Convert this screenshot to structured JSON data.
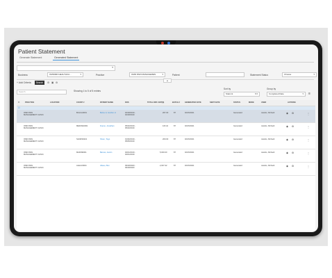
{
  "page": {
    "title": "Patient Statement",
    "tabs": [
      "Generate Statement",
      "Generated Statement"
    ],
    "active_tab": 1
  },
  "filters": {
    "business_label": "Business",
    "business_value": "OMNIMD HEALTHCA...",
    "practice_label": "Practice",
    "practice_value": "OMD PAIN MANAGEMEN",
    "patient_label": "Patient",
    "statement_status_label": "Statement Status",
    "statement_status_value": "Choose"
  },
  "toolbar": {
    "add_criteria": "+ Add Criteria",
    "search_button": "Search",
    "search_placeholder": "Search",
    "showing_text": "Showing 1 to 5 of 5 entries",
    "sort_by_label": "Sort by",
    "sort_by_value": "Statmnt",
    "group_by_label": "Group by",
    "group_by_value": "Completed Date"
  },
  "table": {
    "headers": [
      "PRACTICE",
      "LOCATION",
      "COUNT #",
      "PATIENT NAME",
      "DOS",
      "TOTAL DIFF AMT($)",
      "BATCH #",
      "GENERATED DATE",
      "SENT DATE",
      "STATUS",
      "MODE",
      "USER",
      "ACTIONS"
    ],
    "rows": [
      {
        "practice": "OMD PAIN MANAGEMENT CLINIC",
        "count": "BULCA0001",
        "patient": "Bulca Jr, Gordon H",
        "dos": "02/18/2019 - 02/18/2019",
        "amount": "267.00",
        "batch": "87",
        "generated": "02/15/2021",
        "status": "Generated",
        "user": "Jacobs, Richard"
      },
      {
        "practice": "OMD PAIN MANAGEMENT CLINIC",
        "count": "MEDINA0001",
        "patient": "Dueno, Jonathan",
        "dos": "05/20/2019 - 05/20/2019",
        "amount": "115.44",
        "batch": "87",
        "generated": "02/15/2021",
        "status": "Generated",
        "user": "Jacobs, Richard"
      },
      {
        "practice": "OMD PAIN MANAGEMENT CLINIC",
        "count": "SANDS0021",
        "patient": "Sham, Togo",
        "dos": "01/30/2019 - 05/05/2019",
        "amount": "200.00",
        "batch": "87",
        "generated": "02/15/2021",
        "status": "Generated",
        "user": "Jacobs, Richard"
      },
      {
        "practice": "OMD PAIN MANAGEMENT CLINIC",
        "count": "MARIN0001",
        "patient": "Barnes, Austin",
        "dos": "02/01/2019 - 02/01/2019",
        "amount": "5,000.00",
        "batch": "87",
        "generated": "02/15/2021",
        "status": "Generated",
        "user": "Jacobs, Richard"
      },
      {
        "practice": "OMD PAIN MANAGEMENT CLINIC",
        "count": "ALEAU0001",
        "patient": "Alleau, Ben",
        "dos": "09/18/2020 - 09/18/2020",
        "amount": "2,007.32",
        "batch": "87",
        "generated": "02/15/2021",
        "status": "Generated",
        "user": "Jacobs, Richard"
      }
    ]
  }
}
